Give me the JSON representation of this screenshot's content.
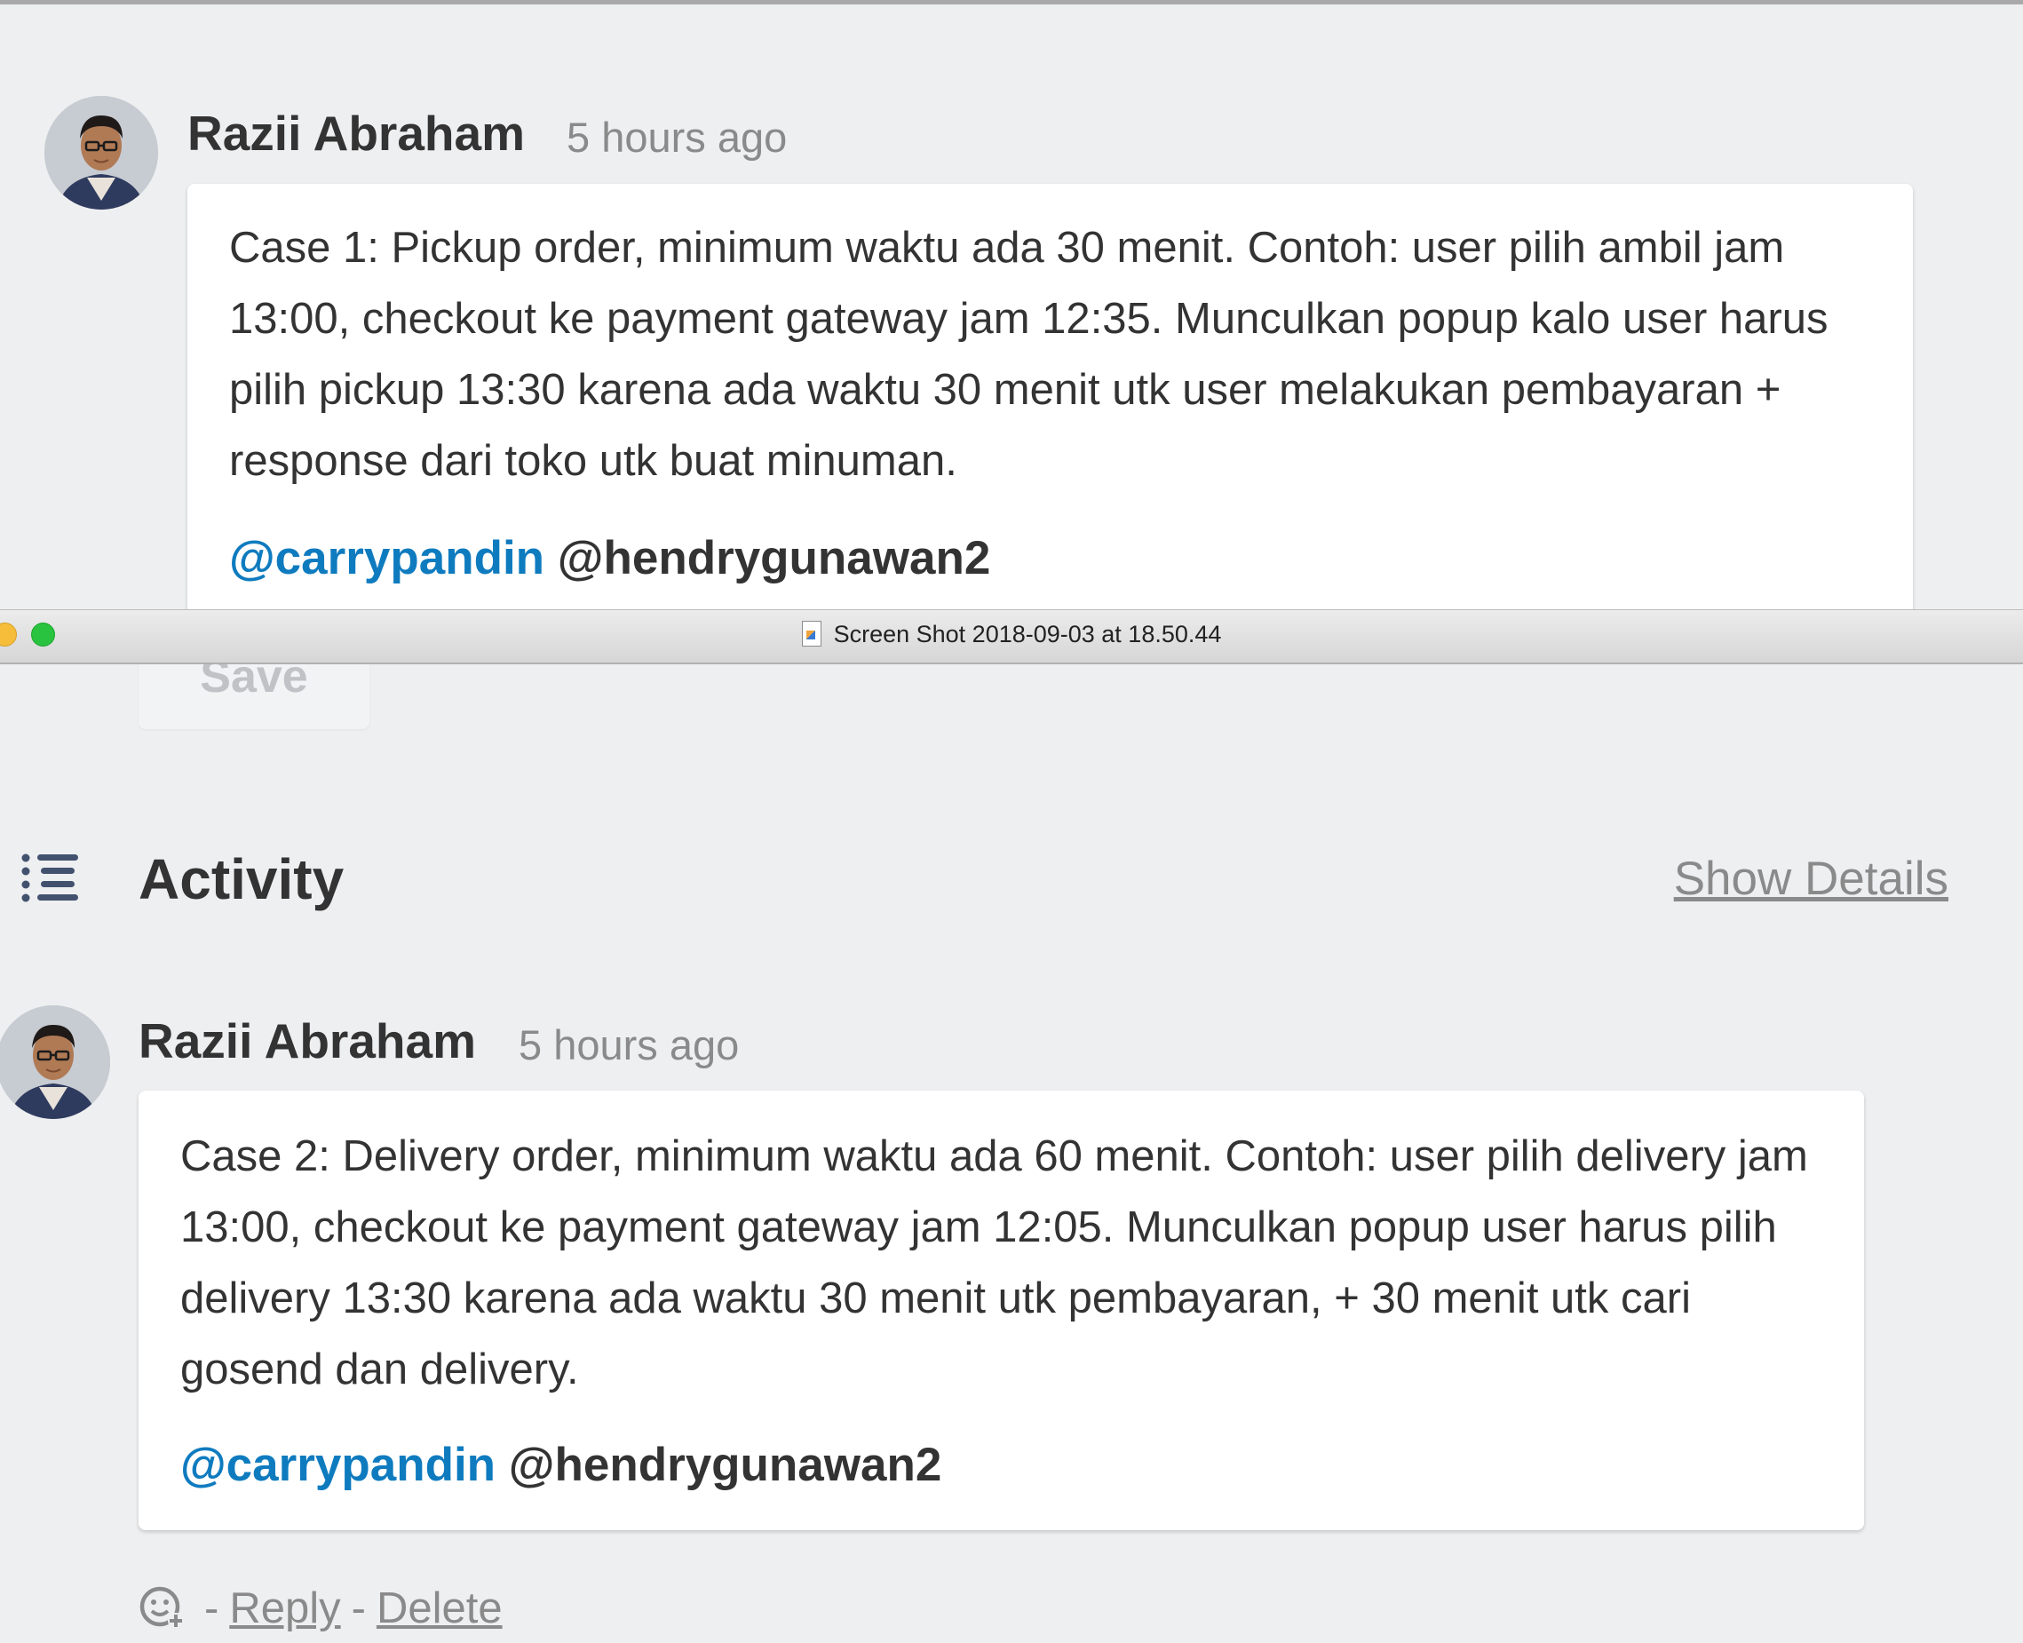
{
  "top_comment": {
    "author": "Razii Abraham",
    "time": "5 hours ago",
    "body": "Case 1: Pickup order, minimum waktu ada 30 menit. Contoh: user pilih ambil jam 13:00, checkout ke payment gateway jam 12:35. Munculkan popup kalo user harus pilih pickup 13:30 karena ada waktu 30 menit utk user melakukan pembayaran + response dari toko utk buat minuman.",
    "mention_link": "@carrypandin",
    "mention_plain": "@hendrygunawan2"
  },
  "window": {
    "title": "Screen Shot 2018-09-03 at 18.50.44"
  },
  "editor": {
    "save_label": "Save"
  },
  "activity": {
    "title": "Activity",
    "show_details": "Show Details"
  },
  "comment": {
    "author": "Razii Abraham",
    "time": "5 hours ago",
    "body": "Case 2: Delivery order, minimum waktu ada 60 menit. Contoh: user pilih delivery jam 13:00, checkout ke payment gateway jam 12:05. Munculkan popup user harus pilih delivery 13:30 karena ada waktu 30 menit utk pembayaran, + 30 menit utk cari gosend dan delivery.",
    "mention_link": "@carrypandin",
    "mention_plain": "@hendrygunawan2",
    "sep": "-",
    "reply": "Reply",
    "delete": "Delete"
  },
  "colors": {
    "background": "#eeeff1",
    "card": "#ffffff",
    "text": "#333333",
    "muted": "#8a8a8a",
    "mention_link": "#0f7bbf",
    "traffic_yellow": "#f5bd3a",
    "traffic_green": "#29c33f"
  },
  "icons": {
    "activity": "list-icon",
    "reaction": "add-emoji-icon",
    "title_doc": "document-icon"
  }
}
